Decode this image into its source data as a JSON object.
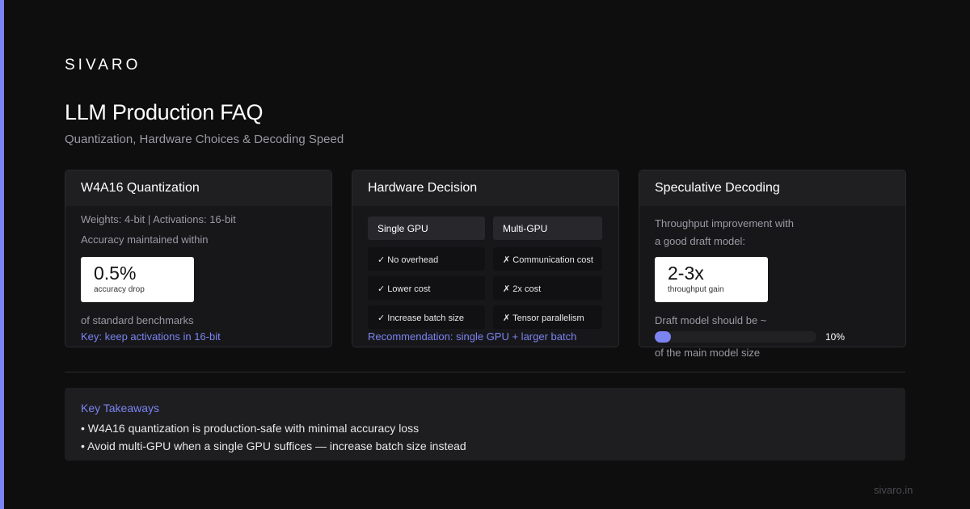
{
  "brand": "SIVARO",
  "title": "LLM Production FAQ",
  "subtitle": "Quantization, Hardware Choices & Decoding Speed",
  "accent_color": "#7b84f0",
  "cards": {
    "quantization": {
      "title": "W4A16 Quantization",
      "line1": "Weights: 4-bit | Activations: 16-bit",
      "line2": "Accuracy maintained within",
      "stat_value": "0.5%",
      "stat_label": "accuracy drop",
      "after": "of standard benchmarks",
      "key": "Key: keep activations in 16-bit"
    },
    "hardware": {
      "title": "Hardware Decision",
      "col1_header": "Single GPU",
      "col2_header": "Multi-GPU",
      "rows": [
        {
          "single": "✓ No overhead",
          "multi": "✗ Communication cost"
        },
        {
          "single": "✓ Lower cost",
          "multi": "✗ 2x cost"
        },
        {
          "single": "✓ Increase batch size",
          "multi": "✗ Tensor parallelism"
        }
      ],
      "recommendation": "Recommendation: single GPU + larger batch"
    },
    "speculative": {
      "title": "Speculative Decoding",
      "line1": "Throughput improvement with",
      "line2": "a good draft model:",
      "stat_value": "2-3x",
      "stat_label": "throughput gain",
      "draft_label": "Draft model should be ~",
      "draft_percent_value": 10,
      "draft_percent": "10%",
      "after": "of the main model size"
    }
  },
  "takeaways": {
    "title": "Key Takeaways",
    "items": [
      "• W4A16 quantization is production-safe with minimal accuracy loss",
      "• Avoid multi-GPU when a single GPU suffices — increase batch size instead"
    ]
  },
  "footer_url": "sivaro.in"
}
